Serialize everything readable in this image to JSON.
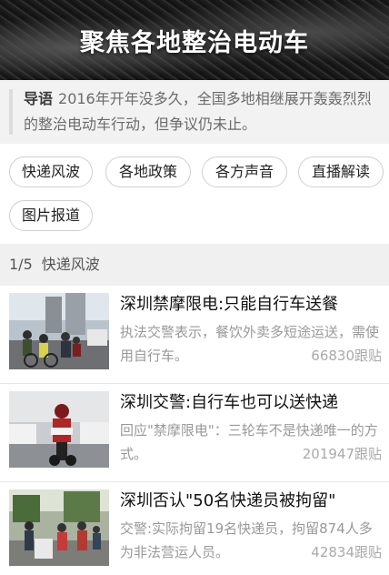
{
  "banner": {
    "title": "聚焦各地整治电动车"
  },
  "intro": {
    "label": "导语",
    "text": "2016年开年没多久，全国多地相继展开轰轰烈烈的整治电动车行动，但争议仍未止。"
  },
  "tags": [
    "快递风波",
    "各地政策",
    "各方声音",
    "直播解读",
    "图片报道"
  ],
  "section": {
    "index": "1/5",
    "title": "快递风波"
  },
  "articles": [
    {
      "title": "深圳禁摩限电:只能自行车送餐",
      "desc": "执法交警表示，餐饮外卖多短途运送，需使用自行车。",
      "count": "66830跟贴"
    },
    {
      "title": "深圳交警:自行车也可以送快递",
      "desc": "回应\"禁摩限电\"：三轮车不是快递唯一的方式。",
      "count": "201947跟贴"
    },
    {
      "title": "深圳否认\"50名快递员被拘留\"",
      "desc": "交警:实际拘留19名快递员，拘留874人多为非法营运人员。",
      "count": "42834跟贴"
    }
  ]
}
